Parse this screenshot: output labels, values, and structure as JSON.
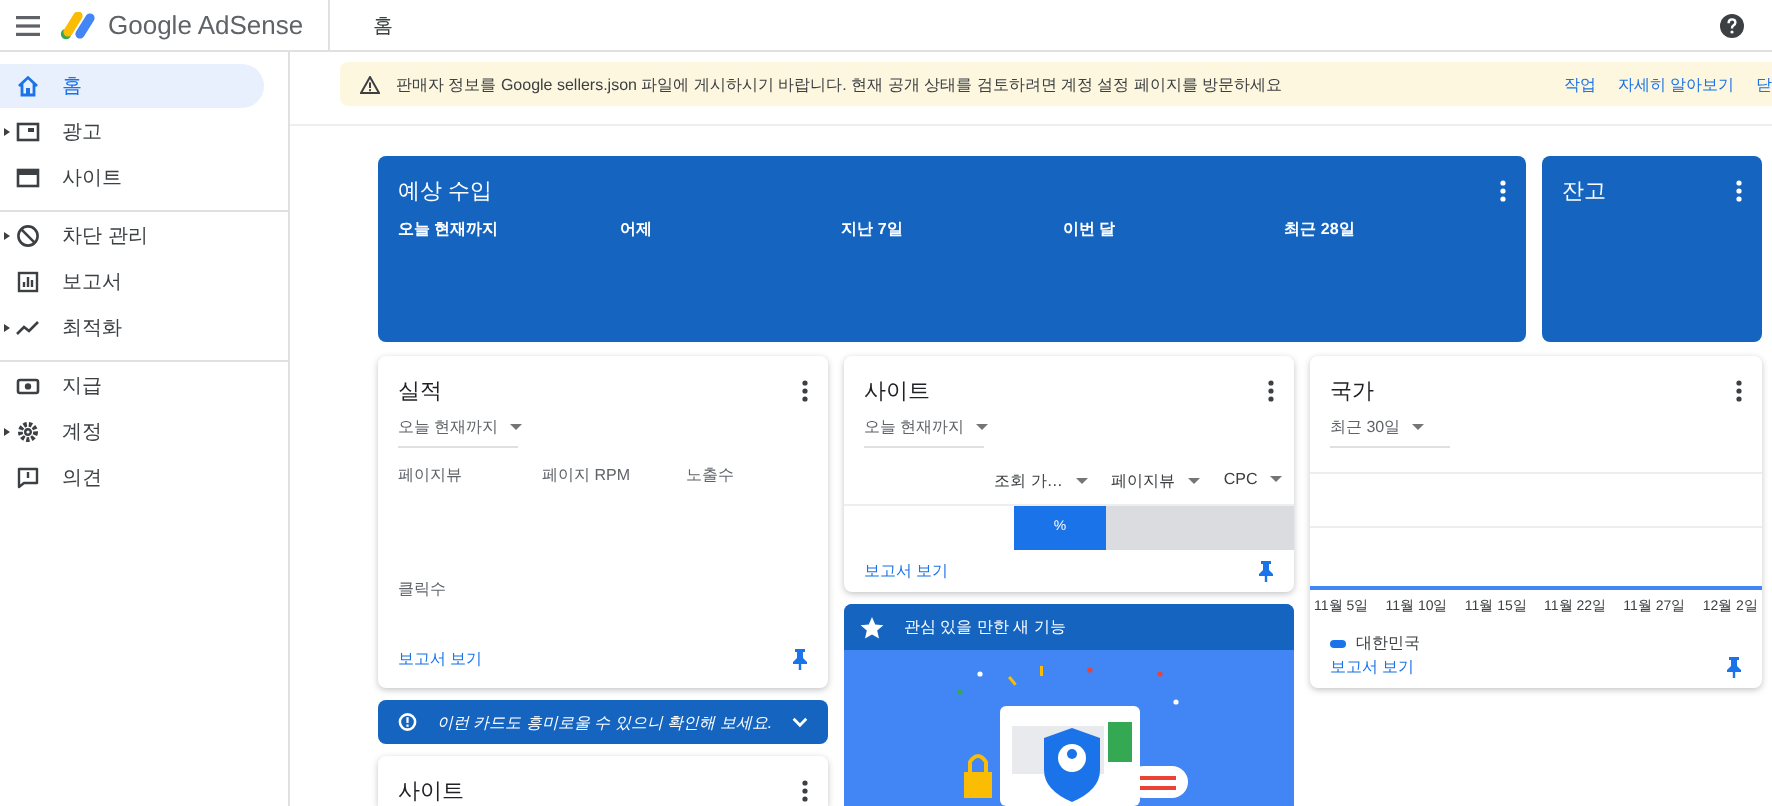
{
  "header": {
    "logo_text": "Google AdSense",
    "page_title": "홈"
  },
  "sidebar": {
    "groups": [
      {
        "items": [
          {
            "label": "홈",
            "selected": true,
            "expandable": false
          },
          {
            "label": "광고",
            "selected": false,
            "expandable": true
          },
          {
            "label": "사이트",
            "selected": false,
            "expandable": false
          }
        ]
      },
      {
        "items": [
          {
            "label": "차단 관리",
            "selected": false,
            "expandable": true
          },
          {
            "label": "보고서",
            "selected": false,
            "expandable": false
          },
          {
            "label": "최적화",
            "selected": false,
            "expandable": true
          }
        ]
      },
      {
        "items": [
          {
            "label": "지급",
            "selected": false,
            "expandable": false
          },
          {
            "label": "계정",
            "selected": false,
            "expandable": true
          },
          {
            "label": "의견",
            "selected": false,
            "expandable": false
          }
        ]
      }
    ]
  },
  "notice": {
    "text": "판매자 정보를 Google sellers.json 파일에 게시하시기 바랍니다. 현재 공개 상태를 검토하려면 계정 설정 페이지를 방문하세요",
    "actions": [
      "작업",
      "자세히 알아보기",
      "닫"
    ]
  },
  "earnings": {
    "title": "예상 수입",
    "columns": [
      "오늘 현재까지",
      "어제",
      "지난 7일",
      "이번 달",
      "최근 28일"
    ]
  },
  "balance": {
    "title": "잔고"
  },
  "performance": {
    "title": "실적",
    "period": "오늘 현재까지",
    "metrics": [
      "페이지뷰",
      "페이지 RPM",
      "노출수",
      "클릭수"
    ],
    "link": "보고서 보기"
  },
  "sites": {
    "title": "사이트",
    "period": "오늘 현재까지",
    "columns": [
      "조회 가…",
      "페이지뷰",
      "CPC"
    ],
    "bar_label": "%",
    "link": "보고서 보기"
  },
  "countries": {
    "title": "국가",
    "period": "최근 30일",
    "x_labels": [
      "11월 5일",
      "11월 10일",
      "11월 15일",
      "11월 22일",
      "11월 27일",
      "12월 2일"
    ],
    "legend": [
      {
        "label": "대한민국",
        "color": "#1a73e8"
      }
    ],
    "link": "보고서 보기"
  },
  "tip": {
    "text": "이런 카드도 흥미로울 수 있으니 확인해 보세요."
  },
  "sites_card": {
    "title": "사이트"
  },
  "new_features": {
    "title": "관심 있을 만한 새 기능"
  }
}
